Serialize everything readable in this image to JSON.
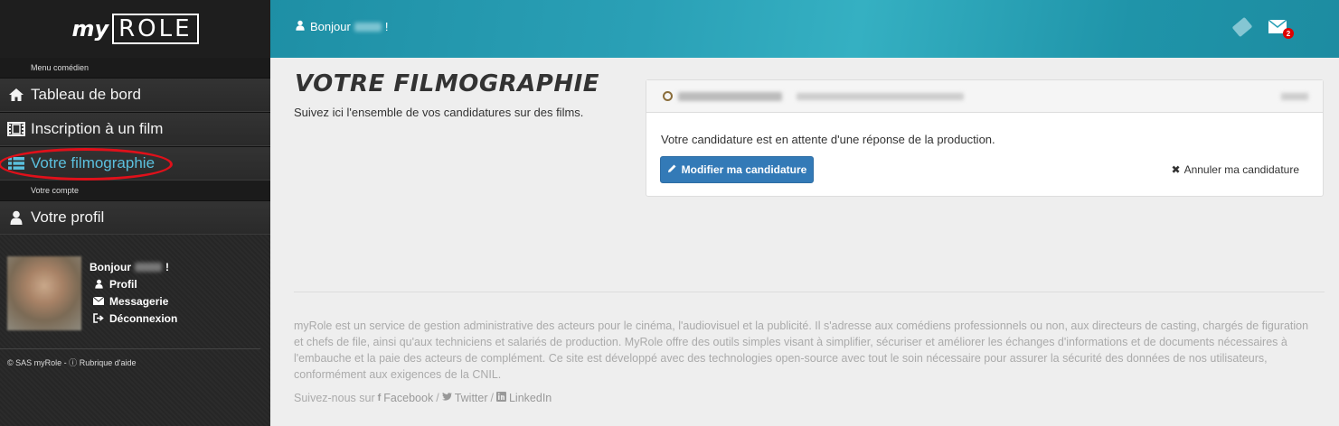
{
  "sidebar": {
    "logo_my": "my",
    "logo_role": "ROLE",
    "section_actor": "Menu comédien",
    "items": [
      {
        "label": "Tableau de bord",
        "icon": "home-icon"
      },
      {
        "label": "Inscription à un film",
        "icon": "film-icon"
      },
      {
        "label": "Votre filmographie",
        "icon": "list-icon"
      }
    ],
    "section_account": "Votre compte",
    "profile_item": {
      "label": "Votre profil",
      "icon": "user-icon"
    },
    "user": {
      "hello": "Bonjour",
      "exclaim": "!",
      "links": [
        "Profil",
        "Messagerie",
        "Déconnexion"
      ]
    },
    "footer": {
      "copyright": "© SAS myRole -",
      "help": "Rubrique d'aide"
    }
  },
  "topbar": {
    "hello": "Bonjour",
    "exclaim": "!",
    "mail_count": "2"
  },
  "main": {
    "title": "VOTRE FILMOGRAPHIE",
    "subtitle": "Suivez ici l'ensemble de vos candidatures sur des films.",
    "card": {
      "message": "Votre candidature est en attente d'une réponse de la production.",
      "edit_label": "Modifier ma candidature",
      "cancel_label": "Annuler ma candidature"
    }
  },
  "footer": {
    "about": "myRole est un service de gestion administrative des acteurs pour le cinéma, l'audiovisuel et la publicité. Il s'adresse aux comédiens professionnels ou non, aux directeurs de casting, chargés de figuration et chefs de file, ainsi qu'aux techniciens et salariés de production. MyRole offre des outils simples visant à simplifier, sécuriser et améliorer les échanges d'informations et de documents nécessaires à l'embauche et la paie des acteurs de complément. Ce site est développé avec des technologies open-source avec tout le soin nécessaire pour assurer la sécurité des données de nos utilisateurs, conformément aux exigences de la CNIL.",
    "follow": "Suivez-nous sur",
    "facebook": "Facebook",
    "twitter": "Twitter",
    "linkedin": "LinkedIn",
    "sep": "/"
  },
  "colors": {
    "accent": "#5bc0de",
    "primary": "#337ab7",
    "highlight": "#e0101a",
    "topbar": "#2aa0b6"
  }
}
